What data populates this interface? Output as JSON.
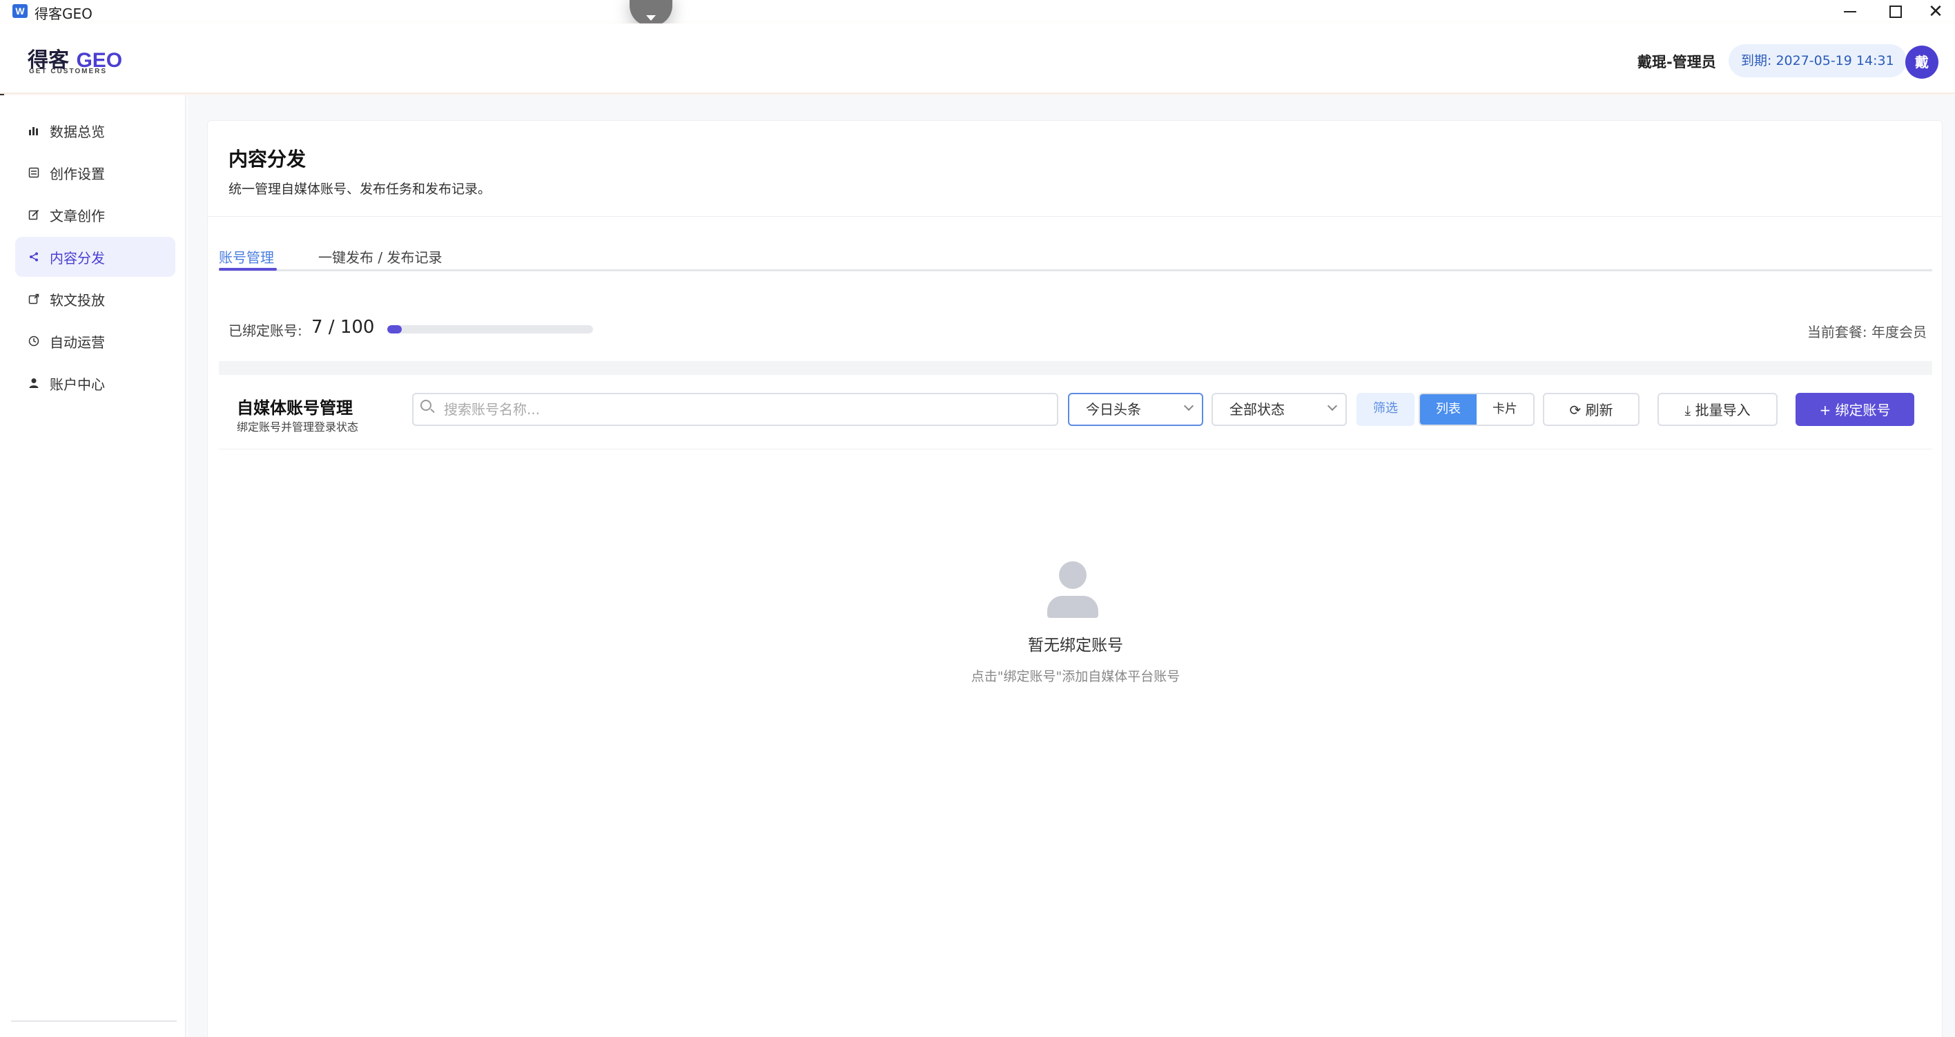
{
  "window": {
    "title": "得客GEO",
    "app_icon_letter": "W"
  },
  "header": {
    "logo_text": "得客",
    "logo_accent": "GEO",
    "logo_tagline": "GET CUSTOMERS",
    "user_name": "戴琨-管理员",
    "expire_text": "到期: 2027-05-19 14:31",
    "avatar_letter": "戴"
  },
  "sidebar": {
    "items": [
      {
        "label": "数据总览",
        "icon": "bar-chart-icon",
        "active": false
      },
      {
        "label": "创作设置",
        "icon": "settings-doc-icon",
        "active": false
      },
      {
        "label": "文章创作",
        "icon": "edit-icon",
        "active": false
      },
      {
        "label": "内容分发",
        "icon": "share-icon",
        "active": true
      },
      {
        "label": "软文投放",
        "icon": "external-link-icon",
        "active": false
      },
      {
        "label": "自动运营",
        "icon": "clock-icon",
        "active": false
      },
      {
        "label": "账户中心",
        "icon": "user-icon",
        "active": false
      }
    ]
  },
  "page": {
    "title": "内容分发",
    "description": "统一管理自媒体账号、发布任务和发布记录。"
  },
  "tabs": [
    {
      "label": "账号管理",
      "active": true
    },
    {
      "label": "一键发布 / 发布记录",
      "active": false
    }
  ],
  "bound": {
    "label": "已绑定账号:",
    "count_text": "7 / 100",
    "progress": 0.07,
    "plan_text": "当前套餐: 年度会员"
  },
  "toolbar": {
    "heading": "自媒体账号管理",
    "subheading": "绑定账号并管理登录状态",
    "search_placeholder": "搜索账号名称...",
    "platform_value": "今日头条",
    "status_value": "全部状态",
    "filter_label": "筛选",
    "view_list_label": "列表",
    "view_card_label": "卡片",
    "refresh_label": "刷新",
    "import_label": "批量导入",
    "bind_label": "+ 绑定账号"
  },
  "empty": {
    "title": "暂无绑定账号",
    "hint": "点击\"绑定账号\"添加自媒体平台账号"
  },
  "colors": {
    "accent": "#5b4fd8",
    "link_blue": "#4b8fef",
    "active_nav_bg": "#eef0fd"
  }
}
